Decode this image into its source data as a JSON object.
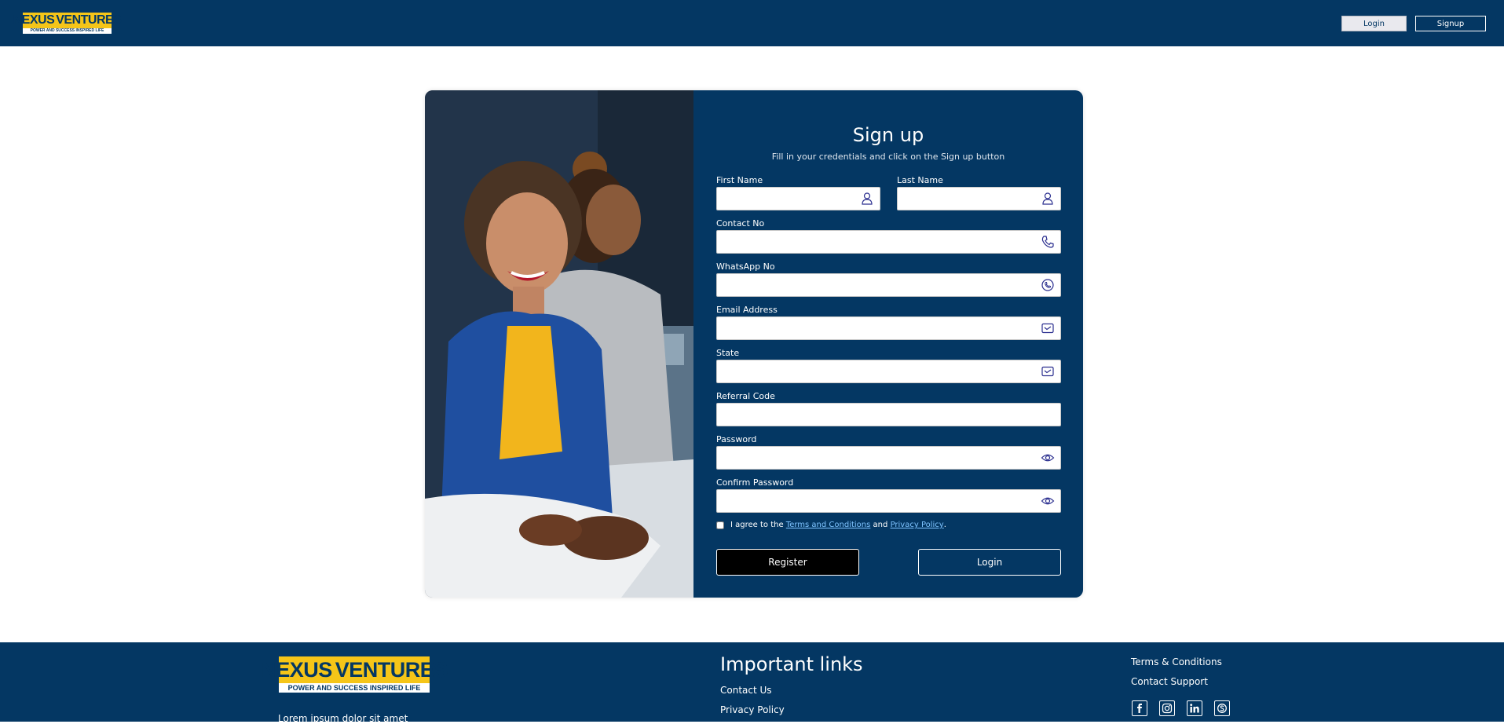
{
  "brand": {
    "name_left": "NEXUS",
    "name_right": "VENTURES",
    "tagline": "POWER AND SUCCESS INSPIRED LIFE"
  },
  "header": {
    "login_label": "Login",
    "signup_label": "Signup"
  },
  "form": {
    "title": "Sign up",
    "subtitle": "Fill in your credentials and click on the Sign up button",
    "fields": {
      "first_name": {
        "label": "First Name",
        "value": "",
        "icon": "user-icon"
      },
      "last_name": {
        "label": "Last Name",
        "value": "",
        "icon": "user-icon"
      },
      "contact": {
        "label": "Contact No",
        "value": "",
        "icon": "phone-icon"
      },
      "whatsapp": {
        "label": "WhatsApp No",
        "value": "",
        "icon": "whatsapp-icon"
      },
      "email": {
        "label": "Email Address",
        "value": "",
        "icon": "mail-icon"
      },
      "state": {
        "label": "State",
        "value": "",
        "icon": "mail-icon"
      },
      "referral": {
        "label": "Referral Code",
        "value": ""
      },
      "password": {
        "label": "Password",
        "value": "",
        "icon": "eye-icon"
      },
      "confirm_password": {
        "label": "Confirm Password",
        "value": "",
        "icon": "eye-icon"
      }
    },
    "agree_prefix": "I agree to the",
    "terms_link": "Terms and Conditions",
    "agree_and": "and",
    "privacy_link": "Privacy Policy",
    "agree_suffix": ".",
    "agree_checked": false,
    "register_label": "Register",
    "login_label": "Login"
  },
  "footer": {
    "lorem": "Lorem ipsum dolor sit amet",
    "important_title": "Important links",
    "contact_us": "Contact Us",
    "privacy_policy": "Privacy Policy",
    "terms": "Terms & Conditions",
    "contact_support": "Contact Support",
    "social": [
      "facebook-icon",
      "instagram-icon",
      "linkedin-icon",
      "skype-icon"
    ]
  },
  "colors": {
    "primary": "#043763",
    "accent": "#f5c518",
    "link": "#7ec3ff",
    "icon": "#2b2f8f"
  }
}
